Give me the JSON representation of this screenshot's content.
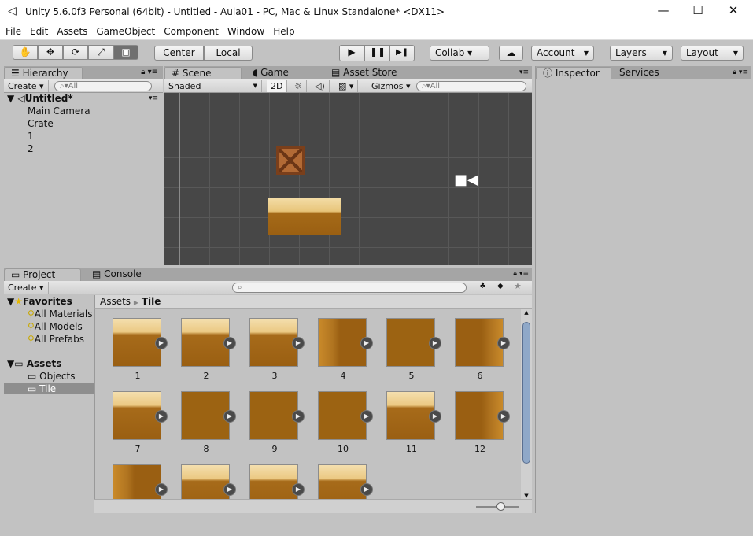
{
  "window": {
    "title": "Unity 5.6.0f3 Personal (64bit) - Untitled - Aula01 - PC, Mac & Linux Standalone* <DX11>",
    "minimize": "—",
    "maximize": "☐",
    "close": "✕"
  },
  "menu": [
    "File",
    "Edit",
    "Assets",
    "GameObject",
    "Component",
    "Window",
    "Help"
  ],
  "toolbar": {
    "tools": [
      "✋",
      "✥",
      "⟳",
      "⤢",
      "▣"
    ],
    "pivot": "Center",
    "space": "Local",
    "play": "▶",
    "pause": "❚❚",
    "step": "▶❚",
    "collab": "Collab ▾",
    "cloud": "☁",
    "account": "Account",
    "layers": "Layers",
    "layout": "Layout"
  },
  "hierarchy": {
    "tab": "Hierarchy",
    "create": "Create ▾",
    "search": "All",
    "scene": "Untitled*",
    "items": [
      "Main Camera",
      "Crate",
      "1",
      "2"
    ]
  },
  "scene": {
    "tabs": [
      "Scene",
      "Game",
      "Asset Store"
    ],
    "shading": "Shaded",
    "mode2d": "2D",
    "gizmos": "Gizmos ▾",
    "search": "All",
    "colors": {
      "background": "#474747",
      "grid": "#585858"
    }
  },
  "inspector": {
    "tabs": [
      "Inspector",
      "Services"
    ]
  },
  "project": {
    "tabs": [
      "Project",
      "Console"
    ],
    "create": "Create ▾",
    "favorites": {
      "label": "Favorites",
      "items": [
        "All Materials",
        "All Models",
        "All Prefabs"
      ]
    },
    "assets": {
      "label": "Assets",
      "items": [
        "Objects",
        "Tile"
      ],
      "selected": "Tile"
    },
    "breadcrumb": [
      "Assets",
      "Tile"
    ],
    "tiles": [
      "1",
      "2",
      "3",
      "4",
      "5",
      "6",
      "7",
      "8",
      "9",
      "10",
      "11",
      "12",
      "",
      "",
      "",
      ""
    ]
  }
}
